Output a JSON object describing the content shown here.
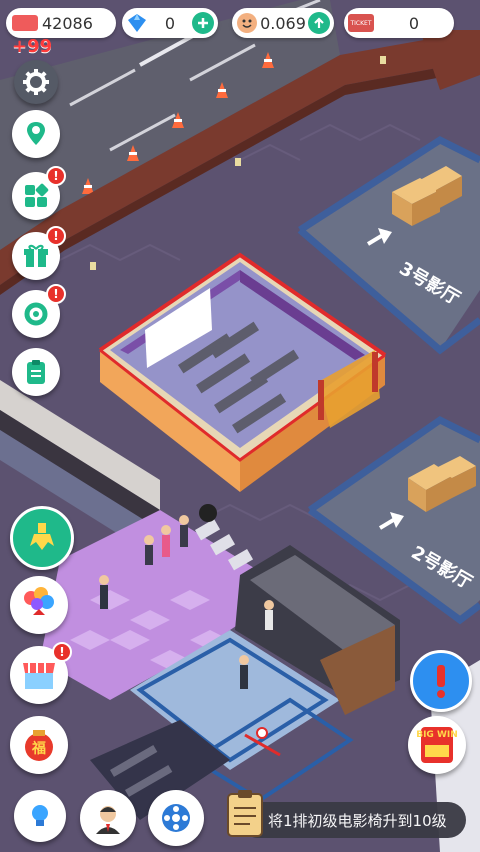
{
  "hud": {
    "money": "42086",
    "money_gain": "+99",
    "gems": "0",
    "faces": "0.069",
    "tickets": "0",
    "ticket_icon_text": "TICKET"
  },
  "map": {
    "hall3_label": "3号影厅",
    "hall2_label": "2号影厅"
  },
  "left_menu": {
    "settings": "settings",
    "map": "map",
    "shop": "shop",
    "gift": "gift",
    "upgrade": "upgrade",
    "tasks": "tasks"
  },
  "big_win_text": "BIG WIN",
  "lucky_char": "福",
  "task": {
    "text": "将1排初级电影椅升到10级"
  },
  "colors": {
    "wall": "#7a3a2e",
    "floor": "#5c5270",
    "parking": "#5f5f6d",
    "hall_pad": "#6a7187",
    "purple_tile": "#c18fe0"
  }
}
